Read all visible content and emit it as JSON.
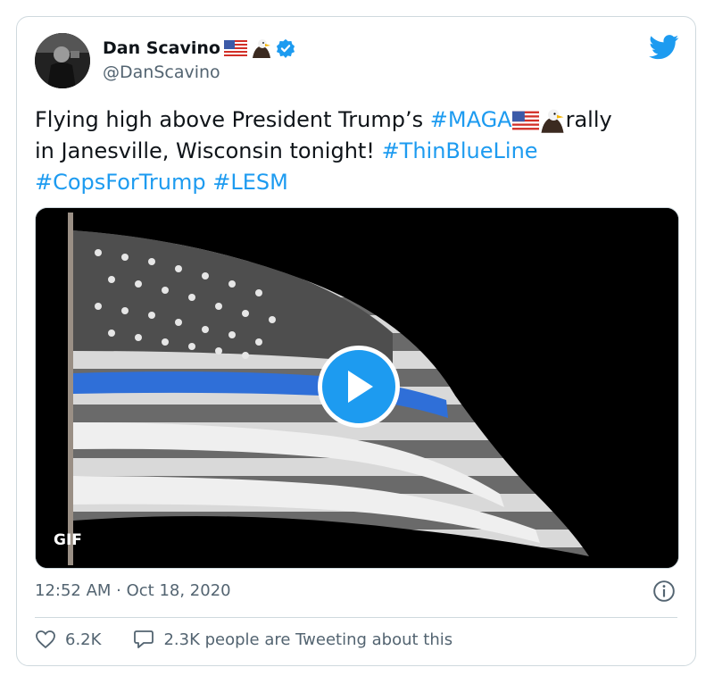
{
  "author": {
    "display_name": "Dan Scavino",
    "handle": "@DanScavino",
    "verified": true
  },
  "tweet": {
    "text_part_1": "Flying high above President Trump’s ",
    "hashtag_1": "#MAGA",
    "text_part_2": "rally",
    "text_part_3": "in Janesville, Wisconsin tonight! ",
    "hashtag_2": "#ThinBlueLine",
    "hashtag_3": "#CopsForTrump",
    "hashtag_4": "#LESM"
  },
  "media": {
    "badge": "GIF"
  },
  "meta": {
    "timestamp": "12:52 AM · Oct 18, 2020"
  },
  "stats": {
    "likes": "6.2K",
    "conversation": "2.3K people are Tweeting about this"
  },
  "colors": {
    "accent": "#1d9bf0",
    "muted": "#536471",
    "border": "#cfd9de"
  },
  "icons": [
    "twitter-logo-icon",
    "verified-badge-icon",
    "us-flag-emoji-icon",
    "eagle-emoji-icon",
    "play-icon",
    "info-icon",
    "heart-icon",
    "speech-bubble-icon"
  ]
}
